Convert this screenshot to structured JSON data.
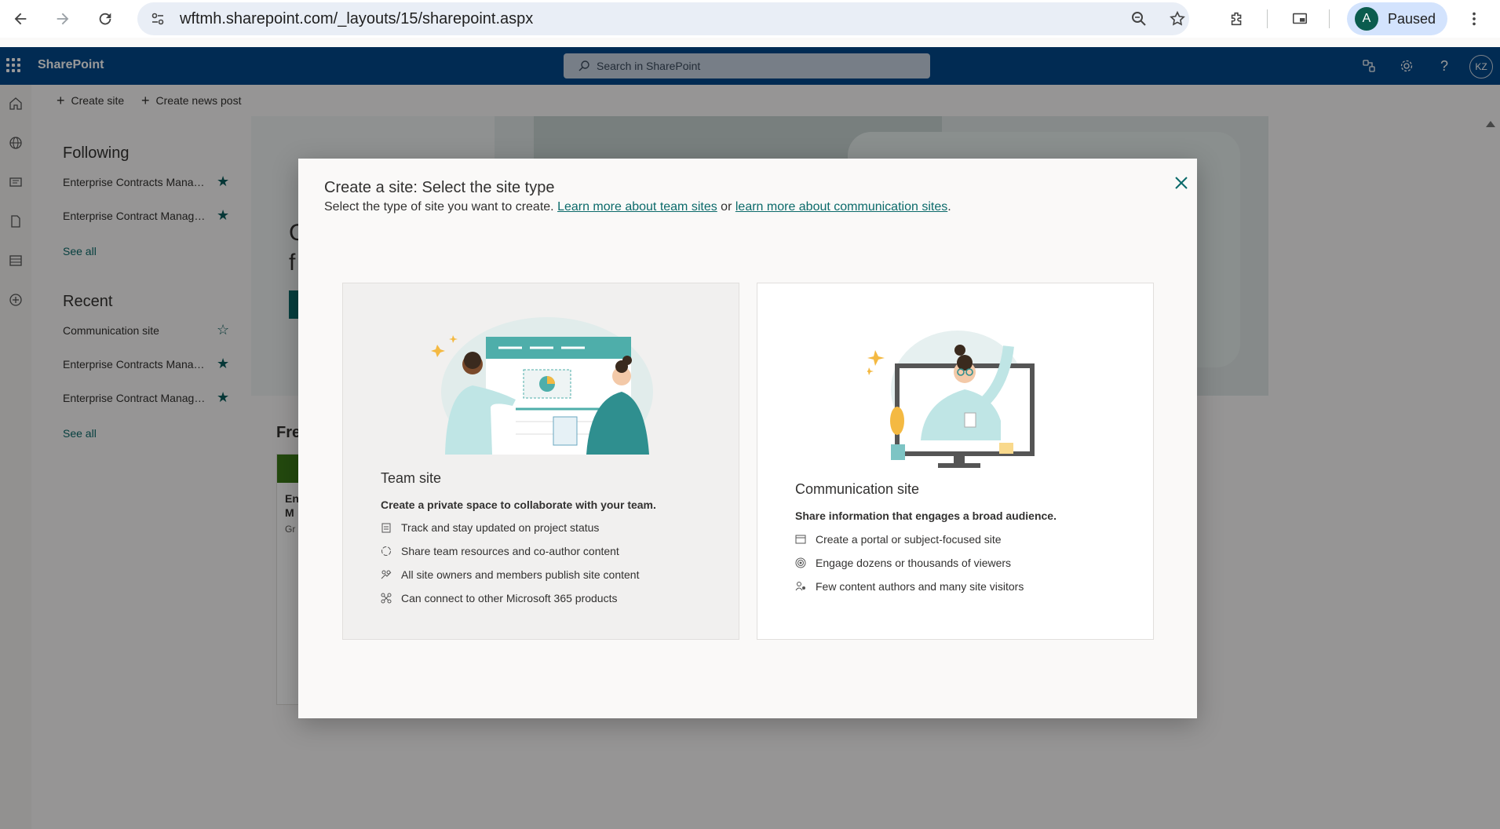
{
  "browser": {
    "url": "wftmh.sharepoint.com/_layouts/15/sharepoint.aspx",
    "profile_initial": "A",
    "profile_status": "Paused"
  },
  "suite": {
    "brand": "SharePoint",
    "search_placeholder": "Search in SharePoint",
    "user_initials": "KZ"
  },
  "commands": {
    "create_site": "Create site",
    "create_news_post": "Create news post"
  },
  "leftnav": {
    "following_heading": "Following",
    "following": [
      {
        "label": "Enterprise Contracts Manag...",
        "starred": true
      },
      {
        "label": "Enterprise Contract Manage...",
        "starred": true
      }
    ],
    "see_all_1": "See all",
    "recent_heading": "Recent",
    "recent": [
      {
        "label": "Communication site",
        "starred": false
      },
      {
        "label": "Enterprise Contracts Manag...",
        "starred": true
      },
      {
        "label": "Enterprise Contract Manage...",
        "starred": true
      }
    ],
    "see_all_2": "See all"
  },
  "main": {
    "frequent_label": "Fre",
    "hero_chars": [
      "C",
      "f"
    ],
    "card_lines": [
      "En",
      "M",
      "Gr"
    ]
  },
  "dialog": {
    "title": "Create a site: Select the site type",
    "subtitle_prefix": "Select the type of site you want to create. ",
    "link_team": "Learn more about team sites",
    "subtitle_or": " or ",
    "link_comm": "learn more about communication sites",
    "subtitle_end": ".",
    "team": {
      "title": "Team site",
      "tagline": "Create a private space to collaborate with your team.",
      "features": [
        "Track and stay updated on project status",
        "Share team resources and co-author content",
        "All site owners and members publish site content",
        "Can connect to other Microsoft 365 products"
      ]
    },
    "communication": {
      "title": "Communication site",
      "tagline": "Share information that engages a broad audience.",
      "features": [
        "Create a portal or subject-focused site",
        "Engage dozens or thousands of viewers",
        "Few content authors and many site visitors"
      ]
    }
  },
  "colors": {
    "suite_blue": "#03488a",
    "accent_teal": "#0b6a6a",
    "star_teal": "#0b5c5c"
  }
}
